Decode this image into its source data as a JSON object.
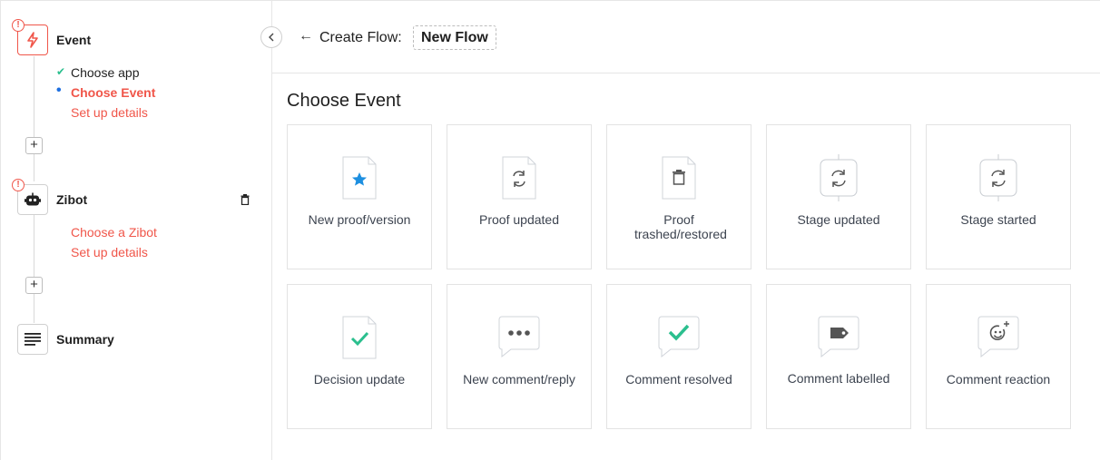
{
  "sidebar": {
    "steps": [
      {
        "title": "Event",
        "subitems": [
          {
            "label": "Choose app",
            "state": "done"
          },
          {
            "label": "Choose Event",
            "state": "current"
          },
          {
            "label": "Set up details",
            "state": "pending"
          }
        ]
      },
      {
        "title": "Zibot",
        "subitems": [
          {
            "label": "Choose a Zibot",
            "state": "pending"
          },
          {
            "label": "Set up details",
            "state": "pending"
          }
        ]
      },
      {
        "title": "Summary"
      }
    ],
    "add_symbol": "+",
    "warn_symbol": "!"
  },
  "header": {
    "back_symbol": "←",
    "label": "Create Flow:",
    "flow_name": "New Flow"
  },
  "main": {
    "title": "Choose Event",
    "events": [
      {
        "label": "New proof/version",
        "icon": "doc-star-icon"
      },
      {
        "label": "Proof updated",
        "icon": "doc-sync-icon"
      },
      {
        "label": "Proof trashed/restored",
        "icon": "doc-trash-icon"
      },
      {
        "label": "Stage updated",
        "icon": "stage-sync-icon"
      },
      {
        "label": "Stage started",
        "icon": "stage-sync-icon"
      },
      {
        "label": "Decision update",
        "icon": "doc-check-icon"
      },
      {
        "label": "New comment/reply",
        "icon": "comment-dots-icon"
      },
      {
        "label": "Comment resolved",
        "icon": "comment-check-icon"
      },
      {
        "label": "Comment labelled",
        "icon": "comment-tag-icon"
      },
      {
        "label": "Comment reaction",
        "icon": "comment-smile-icon"
      }
    ]
  },
  "colors": {
    "accent": "#f0564a",
    "check": "#2bbf8e",
    "current_dot": "#1d6fe0",
    "star": "#1d8fe0"
  }
}
